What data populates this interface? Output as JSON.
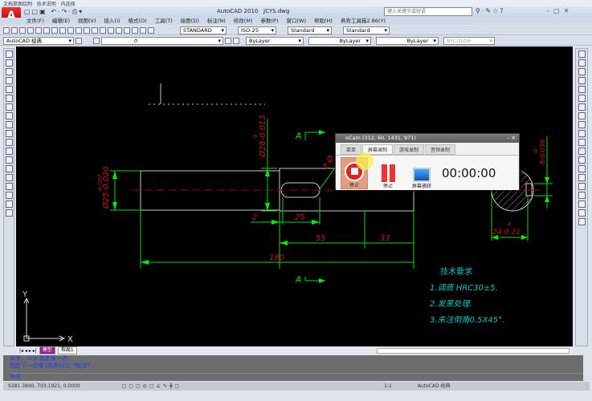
{
  "taskbar_strip": "文档草图绘制 · 技术说明 · 内选择",
  "window": {
    "app": "AutoCAD 2010",
    "file": "JCYS.dwg",
    "search_placeholder": "键入关键字或短语"
  },
  "menu": [
    "文件(F)",
    "编辑(E)",
    "视图(V)",
    "插入(I)",
    "格式(O)",
    "工具(T)",
    "绘图(D)",
    "标注(N)",
    "修改(M)",
    "参数(P)",
    "窗口(W)",
    "帮助(H)",
    "燕秀工具箱2.86(Y)"
  ],
  "toolbar": {
    "text_style": "STANDARD",
    "dim_style": "ISO-25",
    "table_style": "Standard",
    "mleader_style": "Standard"
  },
  "toolbar2": {
    "workspace": "AutoCAD 经典",
    "layer": "0",
    "color": "ByLayer",
    "linetype": "ByLayer",
    "lineweight": "ByLayer",
    "plotstyle": "BYCOLOR"
  },
  "drawing": {
    "dims": {
      "d25": "Ø25-0.020",
      "d25_tol": "-0.007",
      "d28": "Ø28-0.013",
      "d28_tol": "0",
      "two": "2",
      "twentyfive": "25",
      "fiftyfive": "55",
      "thirtythree": "33",
      "oneeighty": "180",
      "chamfer": "2-Ø",
      "section_width": "24-0.21",
      "section_width_tol": "0",
      "key_depth": "8-0.036",
      "key_depth_tol": "0"
    },
    "section_label_top": "A",
    "section_label_bottom": "A",
    "ucs_x": "X",
    "ucs_y": "Y",
    "notes_title": "技术要求",
    "notes": [
      "1.调质 HRC30±5.",
      "2.发黑处理.",
      "3.未注倒角0.5X45°."
    ]
  },
  "colors": {
    "background": "#000000",
    "dimension": "#00ff00",
    "dim_text": "#cc0000",
    "geometry": "#c8c8c8",
    "notes": "#00c8c8",
    "centerline": "#aa0000"
  },
  "tabs": {
    "model": "模型",
    "layout1": "布局1"
  },
  "command": {
    "line1": "命令: _line 指定第一点:",
    "line2": "指定下一点或 [放弃(U)]: *取消*",
    "prompt": "命令:"
  },
  "status": {
    "coords": "9281.3840, 703.1921, 0.0000",
    "scale": "1:1",
    "workspace": "AutoCAD 经典"
  },
  "ocam": {
    "title": "oCam (312, 60, 1431, 971)",
    "tabs": [
      "菜单",
      "屏幕录制",
      "游戏录制",
      "音频录制"
    ],
    "active_tab": "屏幕录制",
    "stop_label": "停止",
    "pause_label": "停止",
    "capture_label": "屏幕捕获",
    "timer": "00:00:00"
  }
}
